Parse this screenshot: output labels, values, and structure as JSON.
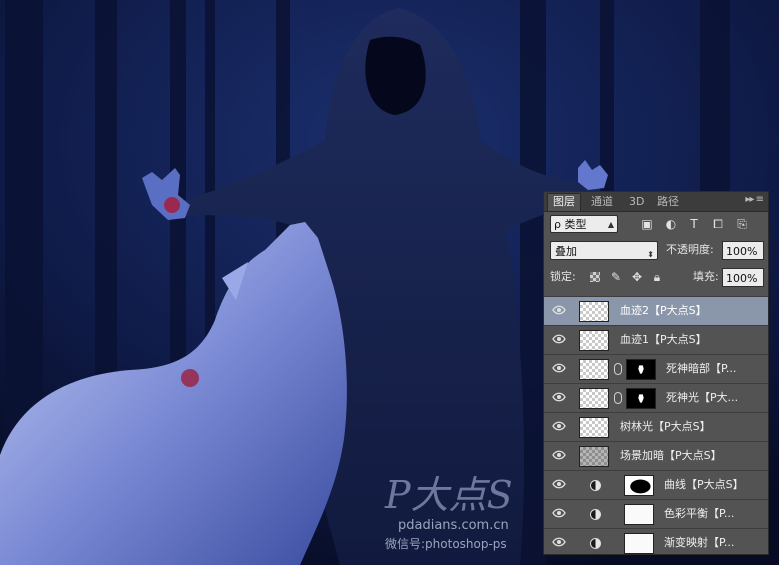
{
  "layers_panel": {
    "tabs": [
      "图层",
      "通道",
      "3D",
      "路径"
    ],
    "active_tab": "图层",
    "filter_kind": "ρ 类型",
    "blend_mode": "叠加",
    "opacity_label": "不透明度:",
    "opacity_value": "100%",
    "lock_label": "锁定:",
    "fill_label": "填充:",
    "fill_value": "100%",
    "selected_highlight_color": "#8a97aa",
    "layers": [
      {
        "name": "血迹2【P大点S】",
        "type": "pixel",
        "selected": true
      },
      {
        "name": "血迹1【P大点S】",
        "type": "pixel",
        "selected": false
      },
      {
        "name": "死神暗部【P...",
        "type": "pixel-mask",
        "selected": false
      },
      {
        "name": "死神光【P大...",
        "type": "pixel-mask",
        "selected": false
      },
      {
        "name": "树林光【P大点S】",
        "type": "pixel",
        "selected": false
      },
      {
        "name": "场景加暗【P大点S】",
        "type": "pixel",
        "selected": false
      },
      {
        "name": "曲线【P大点S】",
        "type": "adjustment",
        "selected": false
      },
      {
        "name": "色彩平衡【P...",
        "type": "adjustment",
        "selected": false
      },
      {
        "name": "渐变映射【P...",
        "type": "adjustment",
        "selected": false
      }
    ]
  },
  "watermark": {
    "logo_text": "P大点S",
    "site": "pdadians.com.cn",
    "wechat": "微信号:photoshop-ps"
  }
}
